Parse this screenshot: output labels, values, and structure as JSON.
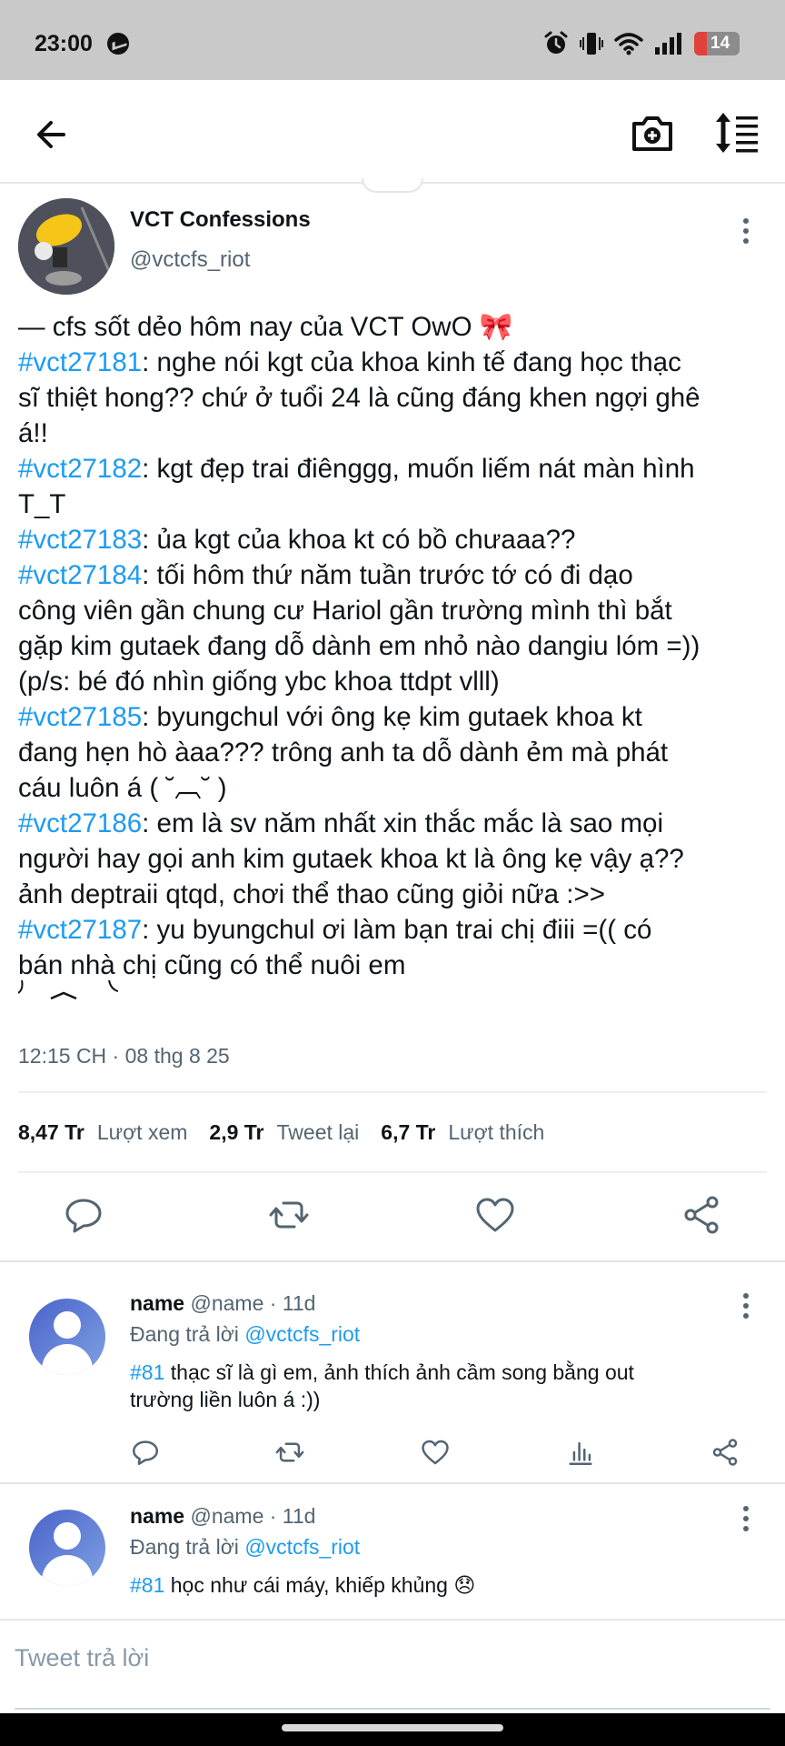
{
  "status_bar": {
    "time": "23:00",
    "battery": "14"
  },
  "header": {
    "back_icon": "arrow-left-icon",
    "camera_icon": "camera-add-icon",
    "sort_icon": "sort-icon"
  },
  "tweet": {
    "author_name": "VCT Confessions",
    "author_handle": "@vctcfs_riot",
    "lines": [
      {
        "tag": "",
        "text": "— cfs sốt dẻo hôm nay của VCT OwO 🎀"
      },
      {
        "tag": "#vct27181",
        "text": ": nghe nói kgt của khoa kinh tế đang học thạc"
      },
      {
        "tag": "",
        "text": "sĩ thiệt hong?? chứ ở tuổi 24 là cũng đáng khen ngợi ghê"
      },
      {
        "tag": "",
        "text": "á!!"
      },
      {
        "tag": "#vct27182",
        "text": ": kgt đẹp trai điênggg, muốn liếm nát màn hình"
      },
      {
        "tag": "",
        "text": "T_T"
      },
      {
        "tag": "#vct27183",
        "text": ": ủa kgt của khoa kt có bồ chưaaa??"
      },
      {
        "tag": "#vct27184",
        "text": ": tối hôm thứ năm tuần trước tớ có đi dạo"
      },
      {
        "tag": "",
        "text": "công viên gần chung cư Hariol gần trường mình thì bắt"
      },
      {
        "tag": "",
        "text": "gặp kim gutaek đang dỗ dành em nhỏ nào dangiu lóm =))"
      },
      {
        "tag": "",
        "text": "(p/s: bé đó nhìn giống ybc khoa ttdpt vlll)"
      },
      {
        "tag": "#vct27185",
        "text": ": byungchul với ông kẹ kim gutaek khoa kt"
      },
      {
        "tag": "",
        "text": "đang hẹn hò àaa??? trông anh ta dỗ dành ẻm mà phát"
      },
      {
        "tag": "",
        "text": "cáu luôn á ( ˘︹˘ )"
      },
      {
        "tag": "#vct27186",
        "text": ": em là sv năm nhất xin thắc mắc là sao mọi"
      },
      {
        "tag": "",
        "text": "người hay gọi anh kim gutaek khoa kt là ông kẹ vậy ạ??"
      },
      {
        "tag": "",
        "text": "ảnh deptraii qtqd, chơi thể thao cũng giỏi nữa :>>"
      },
      {
        "tag": "#vct27187",
        "text": ": yu byungchul ơi làm bạn trai chị điii =(( có"
      },
      {
        "tag": "",
        "text": "bán nhà chị cũng có thể nuôi em"
      }
    ],
    "timestamp": "12:15 CH · 08 thg 8 25",
    "stats": {
      "views_num": "8,47 Tr",
      "views_label": "Lượt xem",
      "retweets_num": "2,9 Tr",
      "retweets_label": "Tweet lại",
      "likes_num": "6,7 Tr",
      "likes_label": "Lượt thích"
    }
  },
  "replies": [
    {
      "name": "name",
      "meta": "@name · 11d",
      "replying_prefix": "Đang trả lời ",
      "replying_handle": "@vctcfs_riot",
      "tag": "#81",
      "text_line1": " thạc sĩ là gì em, ảnh thích ảnh cầm song bằng out",
      "text_line2": "trường liền luôn á :))"
    },
    {
      "name": "name",
      "meta": "@name · 11d",
      "replying_prefix": "Đang trả lời ",
      "replying_handle": "@vctcfs_riot",
      "tag": "#81",
      "text_line1": " học như cái máy, khiếp khủng 😞",
      "text_line2": ""
    }
  ],
  "compose": {
    "placeholder": "Tweet trả lời"
  },
  "colors": {
    "accent": "#1d9bf0",
    "secondary_text": "#536471"
  }
}
